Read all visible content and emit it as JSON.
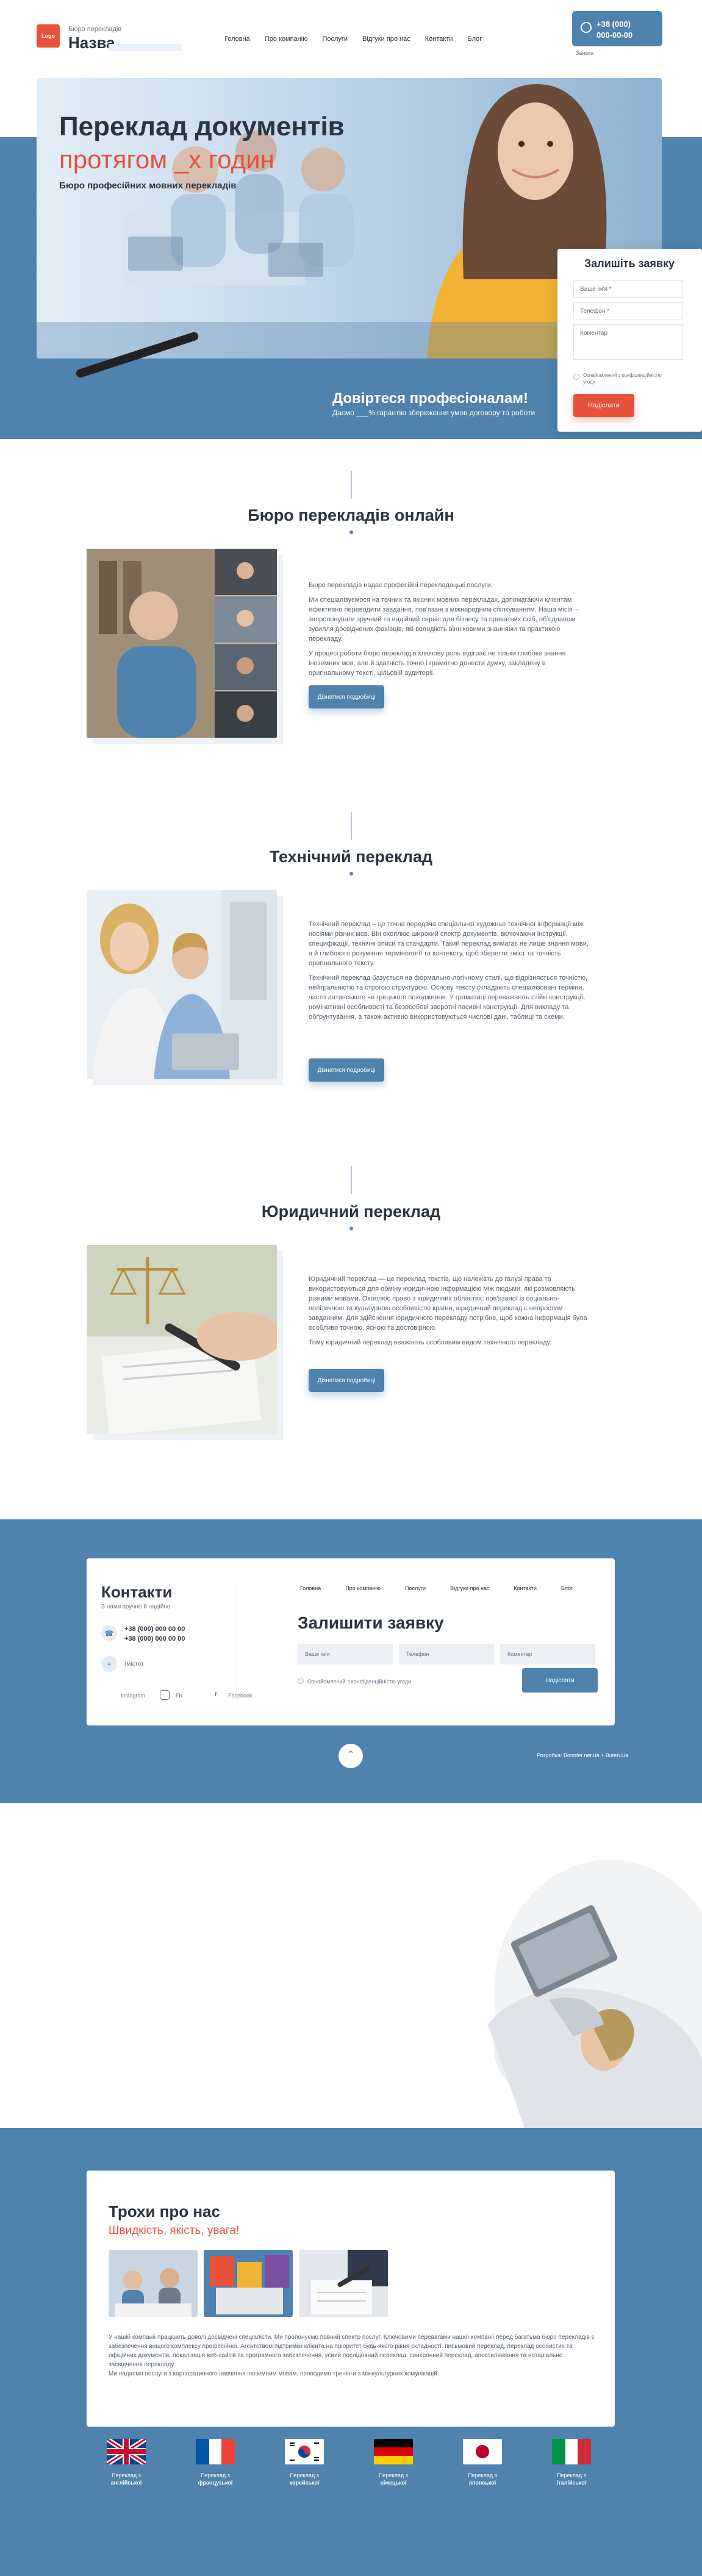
{
  "header": {
    "logo_text": "Logo",
    "logo_subtitle": "Бюро перекладів",
    "logo_name": "Назва",
    "nav": [
      "Головна",
      "Про компанію",
      "Послуги",
      "Відгуки про нас",
      "Контакти",
      "Блог"
    ],
    "phone1": "+38 (000)",
    "phone2": "000-00-00",
    "phone_link": "Заявка"
  },
  "hero": {
    "title_line1": "Переклад документів",
    "title_line2": "протягом _х годин",
    "subtitle": "Бюро професійних мовних перекладів",
    "trust_title": "Довіртеся професіоналам!",
    "trust_sub": "Даємо ___% гарантію збереження умов договору та роботи"
  },
  "request_form": {
    "title": "Залишіть заявку",
    "name_placeholder": "Ваше ім'я *",
    "phone_placeholder": "Телефон *",
    "comment_placeholder": "Коментар",
    "consent": "Ознайомлений з конфіденційністю угоди",
    "submit": "Надіслати"
  },
  "sections": [
    {
      "title": "Бюро перекладів онлайн",
      "paragraphs": [
        "Бюро перекладів надає професійні перекладацькі послуги.",
        "Ми спеціалізуємося на точних та якісних мовних перекладах, допомагаючи клієнтам ефективно переводити завдання, пов'язані з міжнародним спілкуванням. Наша місія – запропонувати зручний та надійний сервіс для бізнесу та приватних осіб, обʼєднавши зусилля досвідчених фахівців, які володіють вінніковими знаннями та практикою перекладу.",
        "У процесі роботи бюро перекладів ключову роль відіграє не тільки глибоке знання іноземних мов, але й здатність точно і грамотно донести думку, закладену в оригінальному тексті, цільовій аудиторії."
      ],
      "button": "Дізнатися подробиці"
    },
    {
      "title": "Технічний переклад",
      "paragraphs": [
        "Технічний переклад – це точна передача спеціальної художньо технічної інформації між носіями різних мов. Він охоплює широкий спектр документів, включаючи інструкції, специфікації, технічні описи та стандарти. Такий переклад вимагає не лише знання мови, а й глибокого розуміння термінології та контексту, щоб зберегти зміст та точність оригінального тексту.",
        "Технічний переклад базується на формально-логічному стилі, що відрізняється точністю, нейтральністю та строгою структурою. Основу тексту складають спеціалізовані терміни, часто латинського чи грецького походження. У граматиці переважають стійкі конструкції, номінативні особливості та безособові зворотні пасивні конструкції. Для викладу та обґрунтування, а також активно використовуються числові дані, таблиці та схеми."
      ],
      "button": "Дізнатися подробиці"
    },
    {
      "title": "Юридичний переклад",
      "paragraphs": [
        "Юридичний переклад — це переклад текстів, що належать до галузі права та використовуються для обміну юридичною інформацією між людьми, які розмовляють різними мовами. Охоплює право з юридичних областях, пов'язаної із соціально-політичною та культурною особливістю країни, юридичний переклад є непростим завданням. Для здійснення юридичного перекладу потрібне, щоб кожна інформація була особливо точною, ясною та достовірною.",
        "Тому юридичний переклад вважають особливим видом технічного перекладу."
      ],
      "button": "Дізнатися подробиці"
    }
  ],
  "contacts": {
    "title": "Контакти",
    "subtitle": "З нами зручно й надійно",
    "phone1": "+38 (000) 000 00 00",
    "phone2": "+38 (000) 000 00 00",
    "address": "(місто)",
    "social": [
      "Instagram",
      "Fb",
      "Facebook"
    ],
    "nav": [
      "Головна",
      "Про компанію",
      "Послуги",
      "Відгуки про нас",
      "Контакти",
      "Блог"
    ],
    "form_title": "Залишити заявку",
    "name_placeholder": "Ваше ім'я",
    "phone_placeholder": "Телефон",
    "comment_placeholder": "Коментар",
    "consent": "Ознайомлений з конфіденційністю угоди",
    "submit": "Надіслати",
    "dev_note": "Розробка: Bonofer.net.ua + Buten.Ua"
  },
  "about": {
    "title": "Трохи про нас",
    "subtitle": "Швидкість, якість, увага!",
    "text": "У нашій компанії працюють доволі досвідчені спеціалісти. Ми пропонуємо повний спектр послуг. Ключовими перевагами нашої компанії перед багатьма бюро перекладів є забезпечення вищого комплексу професійної. Агентством підтримки клієнта на пріоритет будь-якого рівня складності: письмовий переклад, переклад особистих та офіційних документів, локалізація веб-сайтів та програмного забезпечення, усний послідовний переклад, синхронний переклад, апостилювання та нотаріальне засвідчення перекладу.\nМи надаємо послуги з корпоративного навчання іноземним мовам, проводимо тренінги з міжкультурних комунікацій."
  },
  "languages": [
    {
      "prefix": "Переклад з",
      "name": "англійської"
    },
    {
      "prefix": "Переклад з",
      "name": "французької"
    },
    {
      "prefix": "Переклад з",
      "name": "корейської"
    },
    {
      "prefix": "Переклад з",
      "name": "німецької"
    },
    {
      "prefix": "Переклад з",
      "name": "японської"
    },
    {
      "prefix": "Переклад з",
      "name": "італійської"
    }
  ],
  "colors": {
    "accent": "#e8523a",
    "brand": "#4f82ad"
  }
}
